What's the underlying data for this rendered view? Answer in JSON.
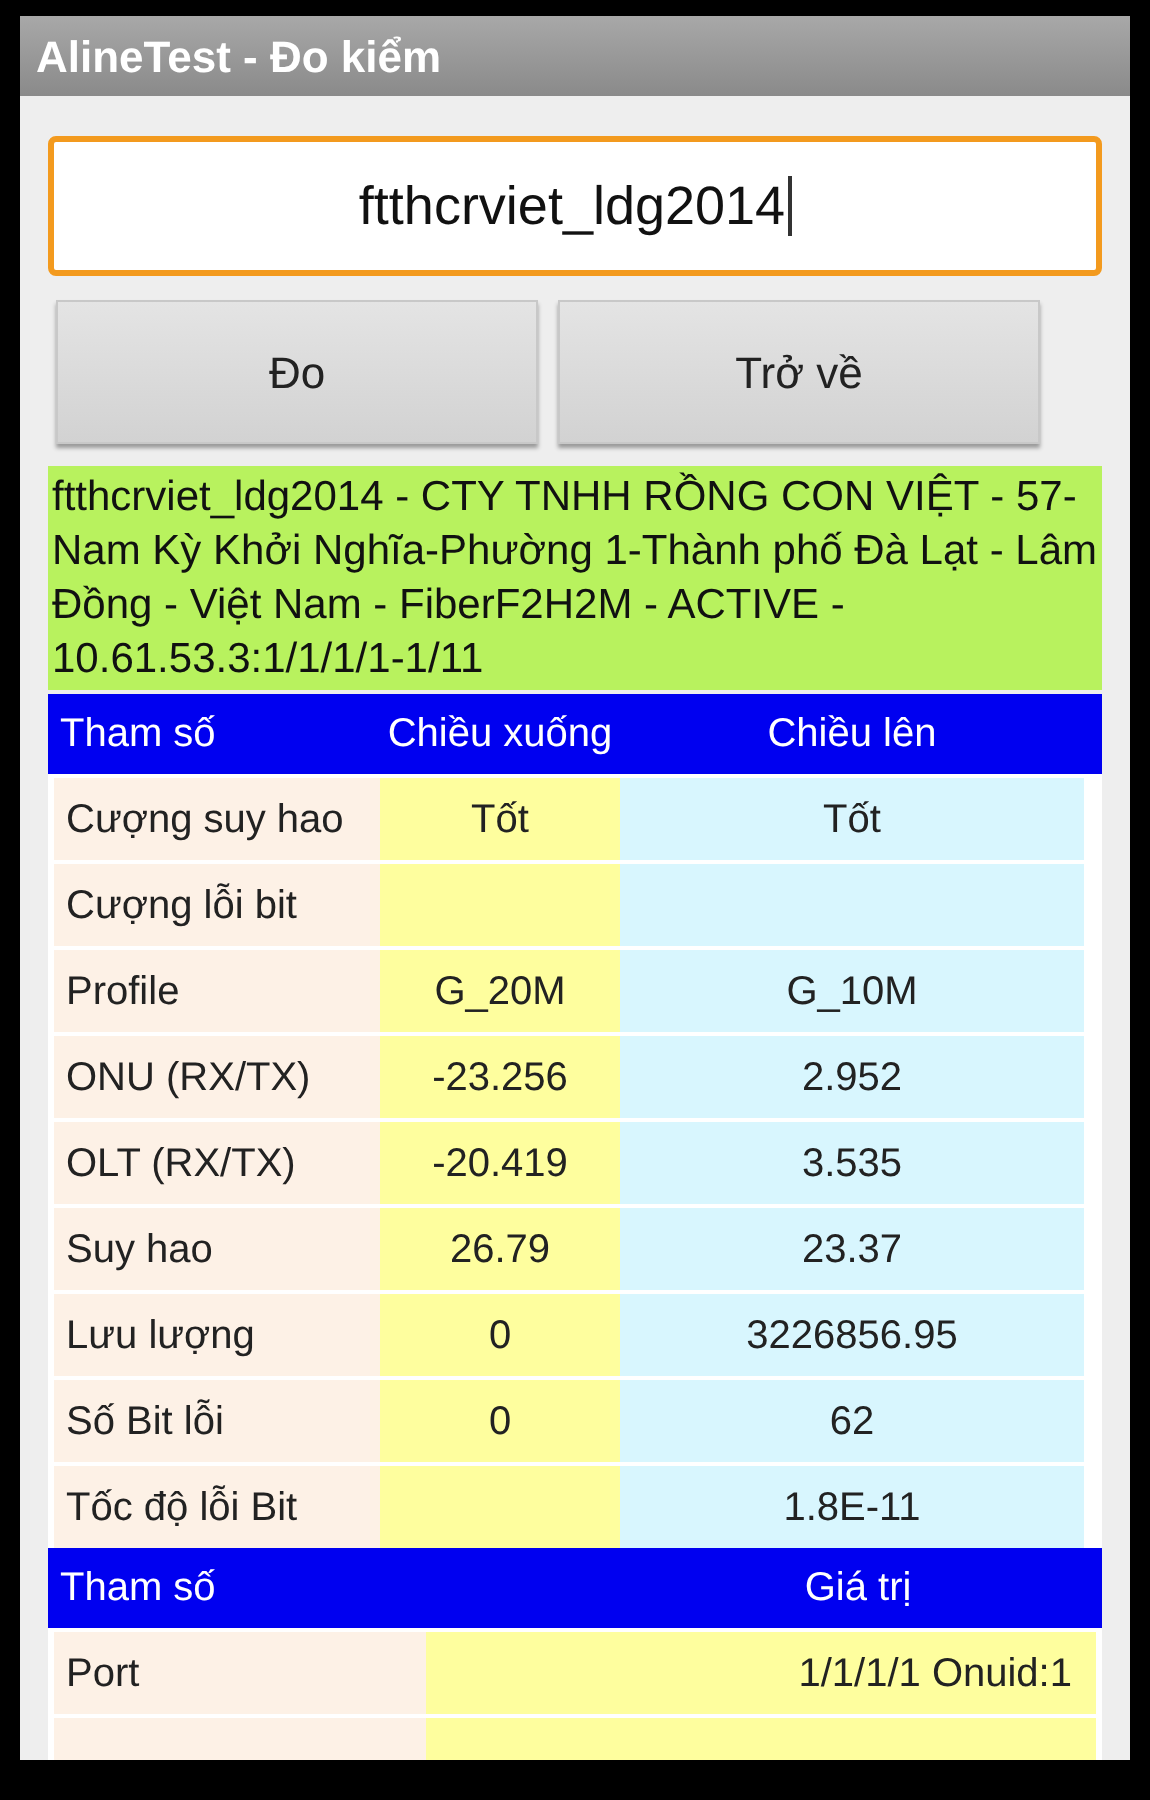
{
  "window": {
    "title": "AlineTest - Đo kiểm"
  },
  "search": {
    "value": "ftthcrviet_ldg2014"
  },
  "buttons": [
    "Đo",
    "Trở về"
  ],
  "info": "ftthcrviet_ldg2014 -  CTY TNHH RỒNG CON VIỆT - 57-Nam Kỳ Khởi Nghĩa-Phường 1-Thành phố Đà Lạt - Lâm Đồng - Việt Nam - FiberF2H2M - ACTIVE - 10.61.53.3:1/1/1/1-1/11",
  "table": {
    "columns": [
      "Tham số",
      "Chiều xuống",
      "Chiều lên"
    ],
    "rows": [
      [
        "Cượng suy hao",
        "Tốt",
        "Tốt"
      ],
      [
        "Cượng lỗi bit",
        "",
        ""
      ],
      [
        "Profile",
        "G_20M",
        "G_10M"
      ],
      [
        "ONU (RX/TX)",
        "-23.256",
        "2.952"
      ],
      [
        "OLT (RX/TX)",
        "-20.419",
        "3.535"
      ],
      [
        "Suy hao",
        "26.79",
        "23.37"
      ],
      [
        "Lưu lượng",
        "0",
        "3226856.95"
      ],
      [
        "Số Bit lỗi",
        "0",
        "62"
      ],
      [
        "Tốc độ lỗi Bit",
        "",
        "1.8E-11"
      ]
    ]
  },
  "table_2": {
    "columns": [
      "Tham số",
      "Giá trị"
    ],
    "rows": [
      [
        "Port",
        "1/1/1/1 Onuid:1"
      ]
    ]
  }
}
